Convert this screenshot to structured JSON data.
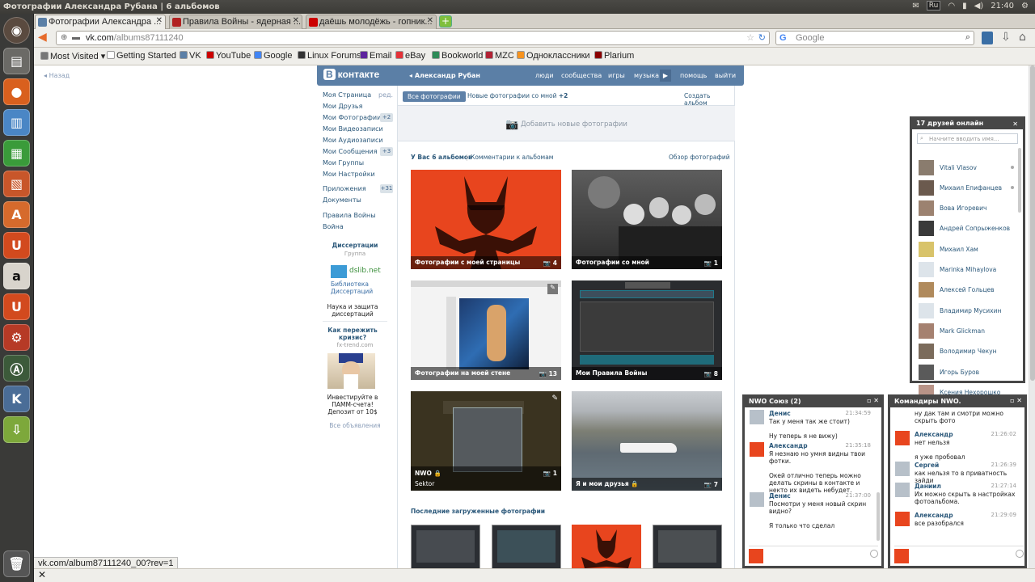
{
  "system_bar": {
    "window_title": "Фотографии Александра Рубана | 6 альбомов",
    "lang": "Ru",
    "clock": "21:40"
  },
  "tabs": [
    {
      "label": "Фотографии Александра ...",
      "favicon_color": "#5b7fa6",
      "active": true
    },
    {
      "label": "Правила Войны - ядерная ...",
      "favicon_color": "#b22222",
      "active": false
    },
    {
      "label": "даёшь молодёжь - гопник...",
      "favicon_color": "#cc0000",
      "active": false
    }
  ],
  "nav": {
    "url_host": "vk.com",
    "url_path": "/albums87111240",
    "search_placeholder": "Google"
  },
  "bookmarks": [
    {
      "label": "Most Visited ▾",
      "color": "#777"
    },
    {
      "label": "Getting Started",
      "color": "#fff"
    },
    {
      "label": "VK",
      "color": "#5b7fa6"
    },
    {
      "label": "YouTube",
      "color": "#cc0000"
    },
    {
      "label": "Google",
      "color": "#4285f4"
    },
    {
      "label": "Linux Forums",
      "color": "#333"
    },
    {
      "label": "Email",
      "color": "#5f259f"
    },
    {
      "label": "eBay",
      "color": "#e53238"
    },
    {
      "label": "Bookworld",
      "color": "#2e8b57"
    },
    {
      "label": "MZC",
      "color": "#b22234"
    },
    {
      "label": "Одноклассники",
      "color": "#f7931e"
    },
    {
      "label": "Plarium",
      "color": "#8b0000"
    }
  ],
  "vk": {
    "back_label": "Назад",
    "logo_text": "контакте",
    "logo_letter": "В",
    "user_name": "Александр Рубан",
    "top_nav": [
      "люди",
      "сообщества",
      "игры",
      "музыка",
      "помощь",
      "выйти"
    ],
    "left_menu": [
      {
        "label": "Моя Страница",
        "extra": "ред."
      },
      {
        "label": "Мои Друзья",
        "extra": ""
      },
      {
        "label": "Мои Фотографии",
        "extra": "+2"
      },
      {
        "label": "Мои Видеозаписи",
        "extra": ""
      },
      {
        "label": "Мои Аудиозаписи",
        "extra": ""
      },
      {
        "label": "Мои Сообщения",
        "extra": "+3"
      },
      {
        "label": "Мои Группы",
        "extra": ""
      },
      {
        "label": "Мои Настройки",
        "extra": ""
      },
      {
        "label": "Приложения",
        "extra": "+31"
      },
      {
        "label": "Документы",
        "extra": ""
      },
      {
        "label": "Правила Войны",
        "extra": ""
      },
      {
        "label": "Война",
        "extra": ""
      }
    ],
    "ads": {
      "group_title": "Диссертации",
      "group_sub": "Группа",
      "dslib": "dslib.net",
      "dslib_text": "Библиотека Диссертаций",
      "dslib_desc": "Наука и защита диссертаций",
      "crisis_title": "Как пережить кризис?",
      "crisis_site": "fx-trend.com",
      "crisis_desc": "Инвестируйте в ПАММ-счета! Депозит от 10$",
      "all_ads": "Все объявления"
    },
    "content_tabs": {
      "all": "Все фотографии",
      "new": "Новые фотографии со мной",
      "new_count": "+2",
      "create": "Создать альбом"
    },
    "add_photos": "Добавить новые фотографии",
    "albums_summary": "У Вас 6 альбомов",
    "album_comments": "Комментарии к альбомам",
    "overview": "Обзор фотографий",
    "albums": [
      {
        "title": "Фотографии с моей страницы",
        "count": "4"
      },
      {
        "title": "Фотографии со мной",
        "count": "1"
      },
      {
        "title": "Фотографии на моей стене",
        "count": "13"
      },
      {
        "title": "Мои Правила Войны",
        "count": "8"
      },
      {
        "title": "NWO",
        "subtitle": "Sektor",
        "count": "1"
      },
      {
        "title": "Я и мои друзья",
        "count": "7"
      }
    ],
    "recent_title": "Последние загруженные фотографии"
  },
  "friends_online": {
    "title": "17 друзей онлайн",
    "search_placeholder": "Начните вводить имя...",
    "list": [
      "Vitali Vlasov",
      "Михаил Епифанцев",
      "Вова Игоревич",
      "Андрей Сопрыженков",
      "Михаил Хам",
      "Marinka Mihaylova",
      "Алексей Гольцев",
      "Владимир Мусихин",
      "Mark Glickman",
      "Володимир Чекун",
      "Игорь Буров",
      "Ксения Нехорошко"
    ]
  },
  "chat1": {
    "title": "NWO Союз (2)",
    "messages": [
      {
        "name": "Денис",
        "time": "21:34:59",
        "text": "Так у меня так же стоит)\n\nНу теперь я не вижу)"
      },
      {
        "name": "Александр",
        "time": "21:35:18",
        "text": "Я незнаю но умня видны твои фотки.\n\nОкей отлично теперь можно делать скрины в контакте и некто их видеть небудет."
      },
      {
        "name": "Денис",
        "time": "21:37:00",
        "text": "Посмотри у меня новый скрин видно?\n\nЯ только что сделал"
      }
    ]
  },
  "chat2": {
    "title": "Командиры NWO.",
    "messages": [
      {
        "name": "",
        "time": "",
        "text": "ну дак там и смотри можно скрыть фото"
      },
      {
        "name": "Александр",
        "time": "21:26:02",
        "text": "нет нельзя\n\nя уже пробовал"
      },
      {
        "name": "Сергей",
        "time": "21:26:39",
        "text": "как нельзя то в приватность зайди"
      },
      {
        "name": "Даниил",
        "time": "21:27:14",
        "text": "Их можно скрыть в настройках фотоальбома."
      },
      {
        "name": "Александр",
        "time": "21:29:09",
        "text": "все разобрался"
      }
    ]
  },
  "status_url": "vk.com/album87111240_00?rev=1"
}
